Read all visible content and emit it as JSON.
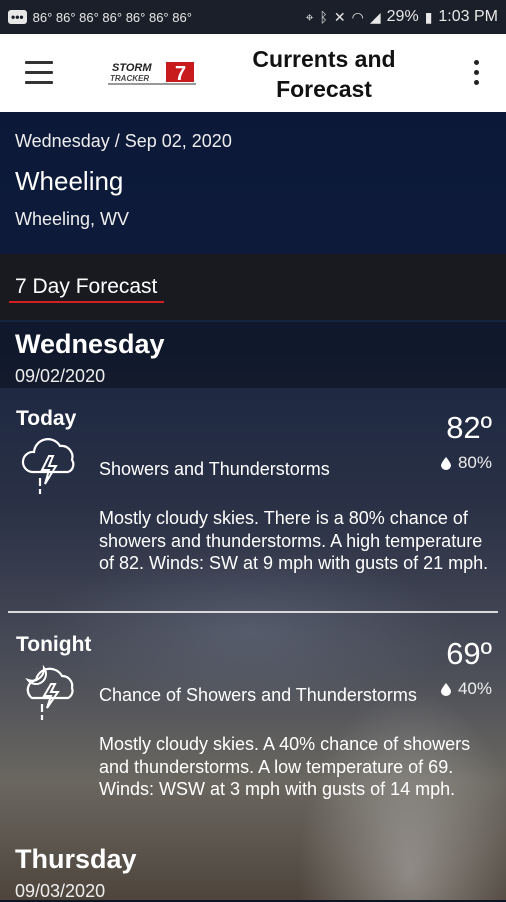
{
  "status_bar": {
    "temps": "86° 86° 86° 86° 86° 86° 86°",
    "battery": "29%",
    "time": "1:03 PM",
    "icons": [
      "location-icon",
      "bluetooth-icon",
      "mute-icon",
      "wifi-icon",
      "signal-icon",
      "battery-icon"
    ]
  },
  "app_bar": {
    "logo_text_top": "STORM",
    "logo_text_bottom": "TRACKER",
    "logo_number": "7",
    "title_line1": "Currents and",
    "title_line2": "Forecast"
  },
  "location": {
    "date": "Wednesday / Sep 02, 2020",
    "name": "Wheeling",
    "subtitle": "Wheeling, WV"
  },
  "section": {
    "title": "7 Day Forecast"
  },
  "days": [
    {
      "name": "Wednesday",
      "date": "09/02/2020",
      "periods": [
        {
          "label": "Today",
          "temp": "82º",
          "precip": "80%",
          "icon": "thunderstorm-icon",
          "condition": "Showers and Thunderstorms",
          "description": "Mostly cloudy skies. There is a 80% chance of showers and thunderstorms.  A high temperature of 82.  Winds: SW at 9 mph with gusts of 21 mph."
        },
        {
          "label": "Tonight",
          "temp": "69º",
          "precip": "40%",
          "icon": "night-thunderstorm-icon",
          "condition": "Chance of Showers and Thunderstorms",
          "description": "Mostly cloudy skies.  A 40% chance of showers and thunderstorms.  A low temperature of 69.  Winds: WSW at 3 mph with gusts of 14 mph."
        }
      ]
    },
    {
      "name": "Thursday",
      "date": "09/03/2020",
      "periods": []
    }
  ],
  "colors": {
    "accent_red": "#d21f1f",
    "app_bar_bg": "#ffffff",
    "status_bar_bg": "#1b1f2a"
  }
}
